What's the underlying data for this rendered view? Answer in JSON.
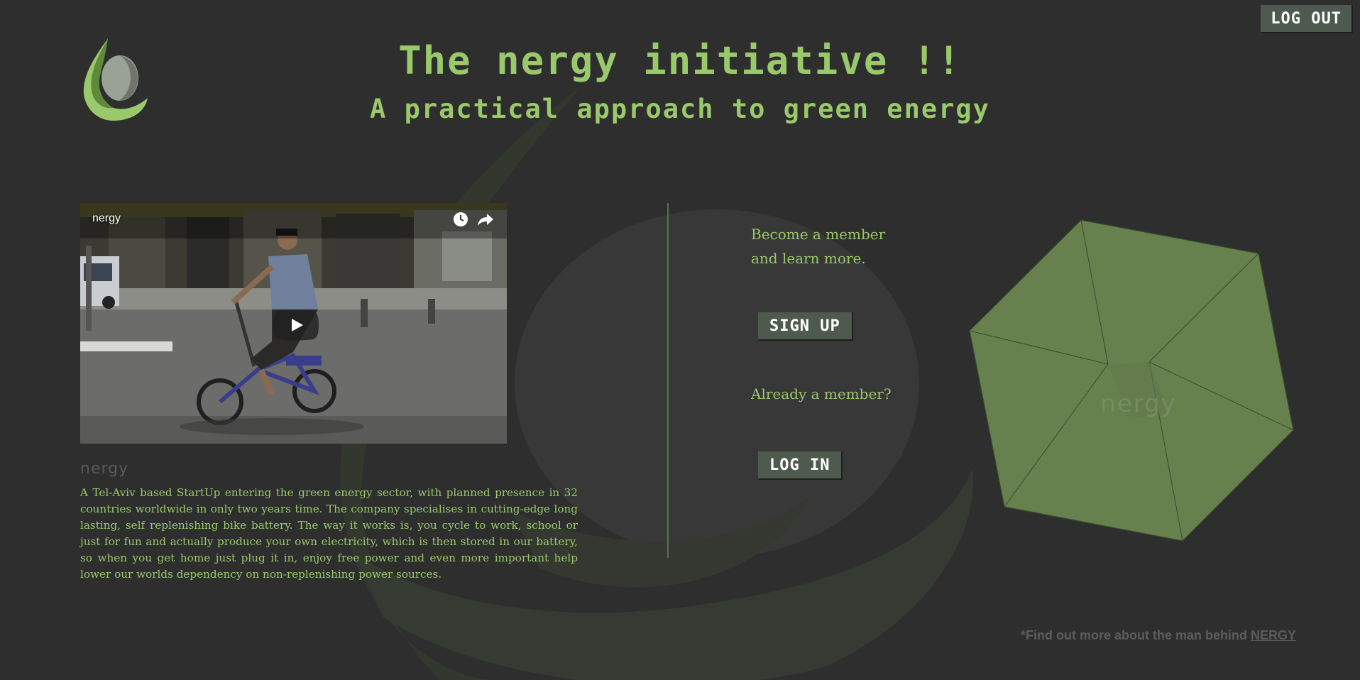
{
  "header": {
    "title": "The nergy initiative !!",
    "subtitle": "A practical approach to green energy",
    "logout_label": "LOG OUT"
  },
  "video": {
    "title": "nergy",
    "icons": [
      "clock-icon",
      "share-icon",
      "play-icon"
    ]
  },
  "about": {
    "brand": "nergy",
    "description": "A Tel-Aviv based StartUp entering the green energy sector, with planned presence in 32 countries worldwide in only two years time. The company specialises in cutting-edge long lasting, self replenishing bike battery. The way it works is, you cycle to work, school or just for fun and actually produce your own electricity, which is then stored in our battery, so when you get home just plug it in, enjoy free power and even more important help lower our worlds dependency on non-replenishing power sources."
  },
  "membership": {
    "become_line1": "Become a member",
    "become_line2": "and learn more.",
    "signup_label": "SIGN UP",
    "already_label": "Already a member?",
    "login_label": "LOG IN"
  },
  "cube": {
    "brand": "nergy"
  },
  "footer": {
    "prefix": "*Find out more about the man behind ",
    "link": "NERGY"
  },
  "colors": {
    "background": "#2e2e2e",
    "accent_green": "#9ac96b",
    "button_bg": "#4f5a4f",
    "cube_green": "#66804e"
  }
}
